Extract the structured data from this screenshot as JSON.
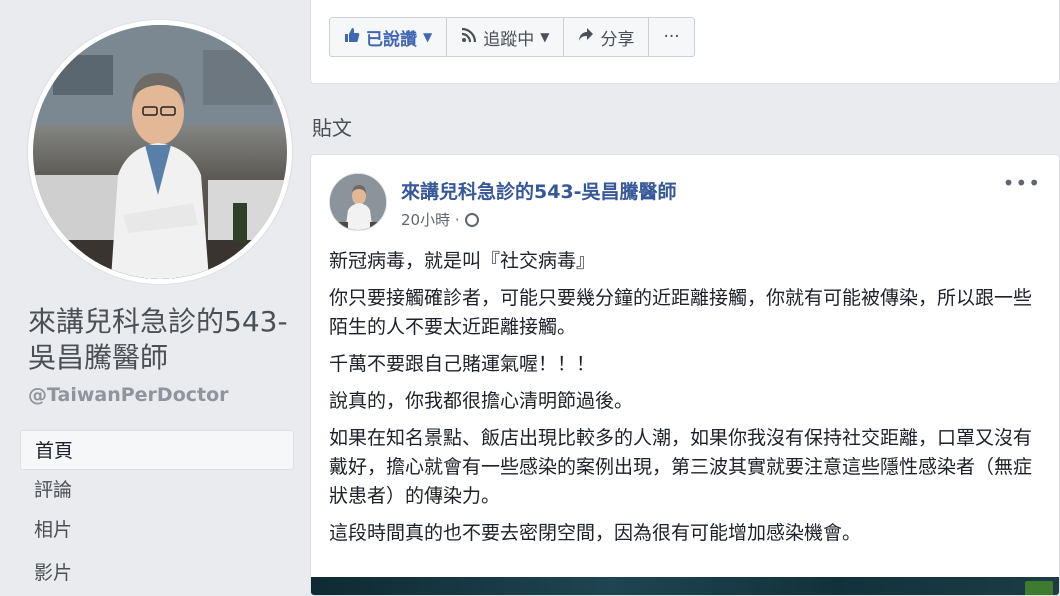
{
  "profile": {
    "name": "來講兒科急診的543-吳昌騰醫師",
    "handle": "@TaiwanPerDoctor"
  },
  "nav": {
    "items": [
      {
        "label": "首頁",
        "active": true
      },
      {
        "label": "評論",
        "active": false
      },
      {
        "label": "相片",
        "active": false
      },
      {
        "label": "影片",
        "active": false
      }
    ]
  },
  "actions": {
    "liked_label": "已說讚",
    "following_label": "追蹤中",
    "share_label": "分享",
    "more_label": "···"
  },
  "section_title": "貼文",
  "post": {
    "author": "來講兒科急診的543-吳昌騰醫師",
    "time": "20小時",
    "more": "•••",
    "paragraphs": [
      "新冠病毒，就是叫『社交病毒』",
      "你只要接觸確診者，可能只要幾分鐘的近距離接觸，你就有可能被傳染，所以跟一些陌生的人不要太近距離接觸。",
      "千萬不要跟自己賭運氣喔！！！",
      "說真的，你我都很擔心清明節過後。",
      "如果在知名景點、飯店出現比較多的人潮，如果你我沒有保持社交距離，口罩又沒有戴好，擔心就會有一些感染的案例出現，第三波其實就要注意這些隱性感染者（無症狀患者）的傳染力。",
      "這段時間真的也不要去密閉空間，因為很有可能增加感染機會。"
    ]
  },
  "colors": {
    "accent": "#4267b2",
    "link": "#365899",
    "background": "#e9ebee"
  }
}
